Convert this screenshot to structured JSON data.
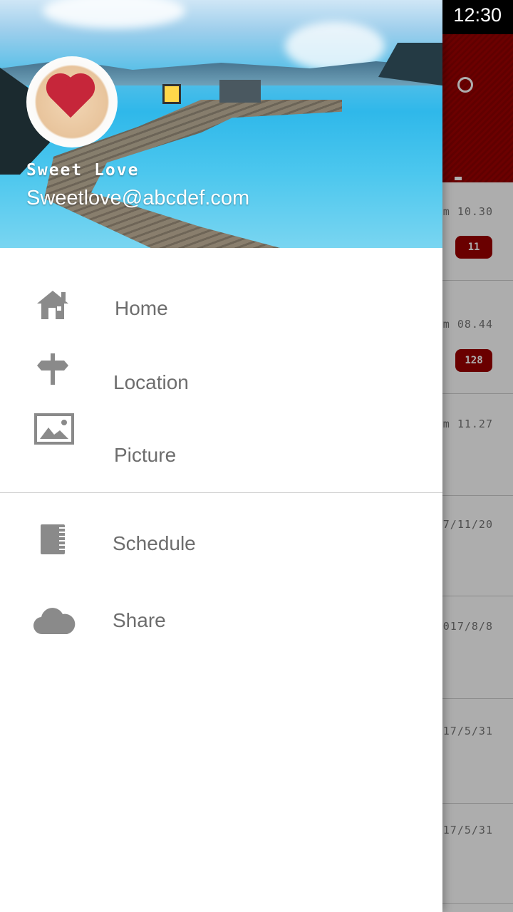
{
  "status_bar": {
    "time": "12:30"
  },
  "drawer": {
    "user": {
      "name": "Sweet Love",
      "email": "Sweetlove@abcdef.com"
    },
    "menu_primary": [
      {
        "label": "Home",
        "icon": "home-icon"
      },
      {
        "label": "Location",
        "icon": "signpost-icon"
      },
      {
        "label": "Picture",
        "icon": "image-icon"
      }
    ],
    "menu_secondary": [
      {
        "label": "Schedule",
        "icon": "notebook-icon"
      },
      {
        "label": "Share",
        "icon": "cloud-icon"
      }
    ]
  },
  "background_list": {
    "rows": [
      {
        "time": "m 10.30",
        "badge": "11"
      },
      {
        "time": "m 08.44",
        "badge": "128"
      },
      {
        "time": "m 11.27",
        "badge": ""
      },
      {
        "time": "7/11/20",
        "badge": ""
      },
      {
        "time": "017/8/8",
        "badge": ""
      },
      {
        "time": "17/5/31",
        "badge": ""
      },
      {
        "time": "17/5/31",
        "badge": ""
      }
    ]
  },
  "colors": {
    "accent": "#9c0000",
    "icon_gray": "#8a8a8a",
    "label_gray": "#6d6d6d"
  }
}
